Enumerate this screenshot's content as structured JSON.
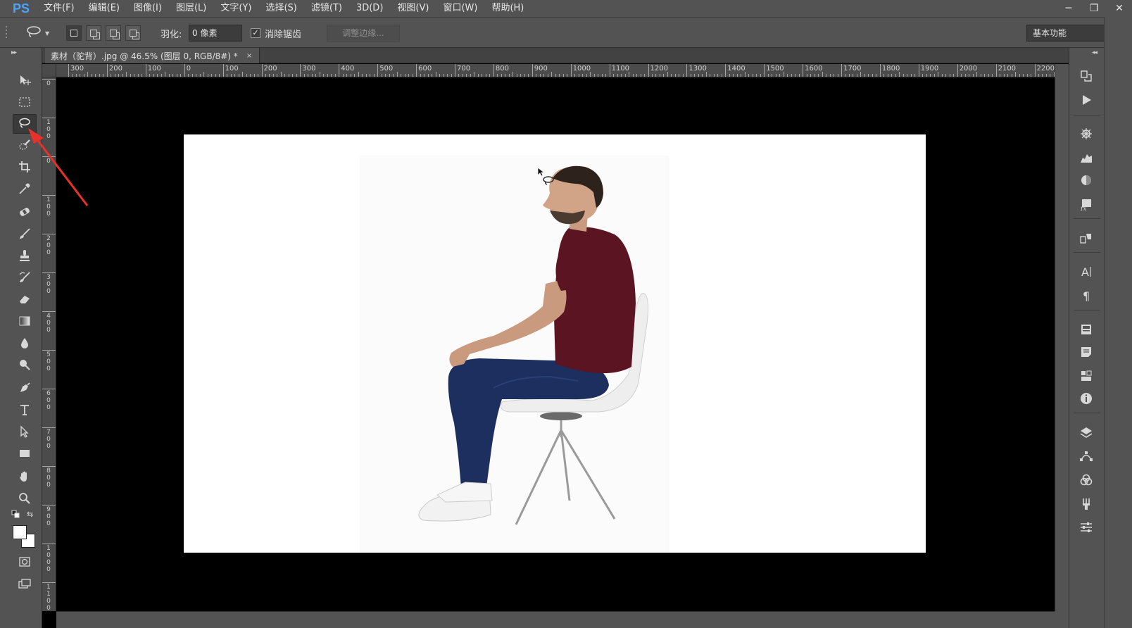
{
  "app": {
    "logo": "PS"
  },
  "menu": [
    "文件(F)",
    "编辑(E)",
    "图像(I)",
    "图层(L)",
    "文字(Y)",
    "选择(S)",
    "滤镜(T)",
    "3D(D)",
    "视图(V)",
    "窗口(W)",
    "帮助(H)"
  ],
  "window_controls": {
    "minimize": "─",
    "restore": "❐",
    "close": "✕"
  },
  "options": {
    "feather_label": "羽化:",
    "feather_value": "0 像素",
    "antialias_label": "消除锯齿",
    "antialias_checked": "✓",
    "refine_edge": "调整边缘...",
    "workspace": "基本功能"
  },
  "document": {
    "tab_title": "素材（驼背）.jpg @ 46.5% (图层 0, RGB/8#) *",
    "close": "×"
  },
  "ruler": {
    "h_labels": [
      "300",
      "200",
      "100",
      "0",
      "100",
      "200",
      "300",
      "400",
      "500",
      "600",
      "700",
      "800",
      "900",
      "1000",
      "1100",
      "1200",
      "1300",
      "1400",
      "1500",
      "1600",
      "1700",
      "1800",
      "1900",
      "2000",
      "2100",
      "2200"
    ],
    "v_labels": [
      "0",
      "100",
      "0",
      "100",
      "200",
      "300",
      "400",
      "500",
      "600",
      "700",
      "800",
      "900",
      "1000",
      "1100"
    ]
  },
  "colors": {
    "foreground": "#ffffff",
    "background": "#ffffff",
    "accent": "#4aa3ff",
    "annotation_arrow": "#e8312a"
  },
  "tools": [
    "move-tool",
    "marquee-tool",
    "lasso-tool",
    "quick-selection-tool",
    "crop-tool",
    "eyedropper-tool",
    "healing-brush-tool",
    "brush-tool",
    "clone-stamp-tool",
    "history-brush-tool",
    "eraser-tool",
    "gradient-tool",
    "blur-tool",
    "dodge-tool",
    "pen-tool",
    "type-tool",
    "path-selection-tool",
    "rectangle-tool",
    "hand-tool",
    "zoom-tool"
  ],
  "active_tool": "lasso-tool",
  "dock_panels": [
    "history-icon",
    "actions-icon",
    "adjustments-icon",
    "histogram-icon",
    "color-icon",
    "styles-icon",
    "clone-source-icon",
    "character-icon",
    "paragraph-icon",
    "libraries-icon",
    "notes-icon",
    "properties-icon",
    "info-icon",
    "layers-icon",
    "paths-icon",
    "channels-icon",
    "brush-presets-icon",
    "tool-presets-icon"
  ]
}
